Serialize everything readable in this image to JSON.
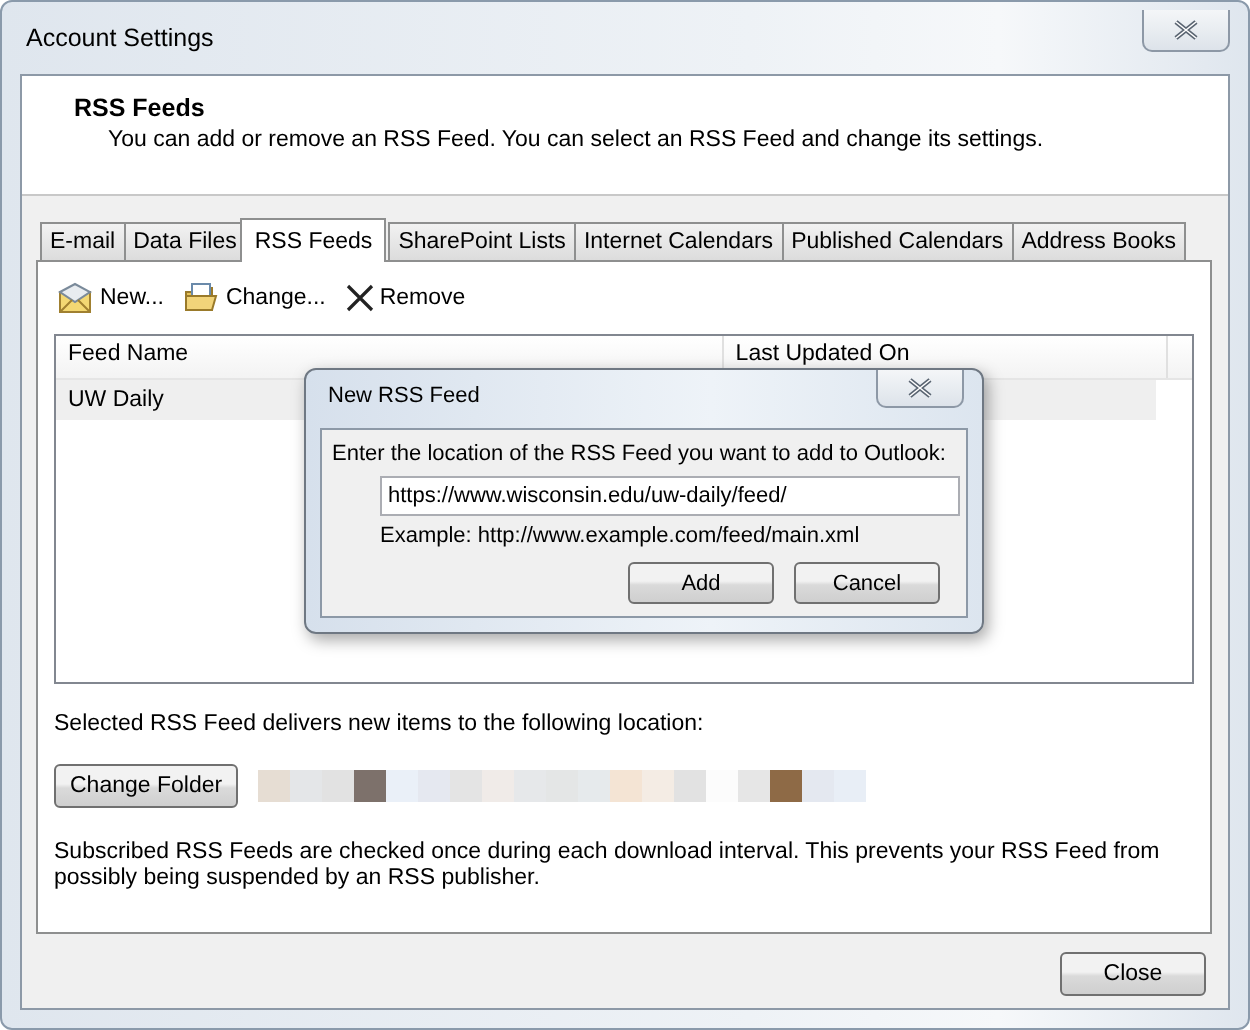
{
  "window": {
    "title": "Account Settings"
  },
  "header": {
    "title": "RSS Feeds",
    "description": "You can add or remove an RSS Feed. You can select an RSS Feed and change its settings."
  },
  "tabs": [
    {
      "label": "E-mail",
      "selected": false
    },
    {
      "label": "Data Files",
      "selected": false
    },
    {
      "label": "RSS Feeds",
      "selected": true
    },
    {
      "label": "SharePoint Lists",
      "selected": false
    },
    {
      "label": "Internet Calendars",
      "selected": false
    },
    {
      "label": "Published Calendars",
      "selected": false
    },
    {
      "label": "Address Books",
      "selected": false
    }
  ],
  "toolbar": [
    {
      "kind": "new",
      "label": "New..."
    },
    {
      "kind": "change",
      "label": "Change..."
    },
    {
      "kind": "remove",
      "label": "Remove"
    }
  ],
  "feeds_table": {
    "columns": [
      "Feed Name",
      "Last Updated On"
    ],
    "rows": [
      {
        "feed_name": "UW Daily",
        "selected": true
      }
    ]
  },
  "location_label": "Selected RSS Feed delivers new items to the following location:",
  "change_folder_button": "Change Folder",
  "note": "Subscribed RSS Feeds are checked once during each download interval. This prevents your RSS Feed from possibly being suspended by an RSS publisher.",
  "close_button": "Close",
  "dialog": {
    "title": "New RSS Feed",
    "prompt": "Enter the location of the RSS Feed you want to add to Outlook:",
    "url_value": "https://www.wisconsin.edu/uw-daily/feed/",
    "example": "Example: http://www.example.com/feed/main.xml",
    "buttons": [
      "Add",
      "Cancel"
    ]
  }
}
